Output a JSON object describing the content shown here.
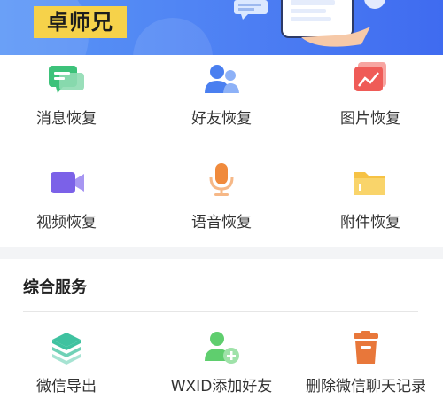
{
  "banner": {
    "brand": "卓师兄"
  },
  "recovery": {
    "items": [
      {
        "label": "消息恢复",
        "icon": "message-icon"
      },
      {
        "label": "好友恢复",
        "icon": "friends-icon"
      },
      {
        "label": "图片恢复",
        "icon": "picture-icon"
      },
      {
        "label": "视频恢复",
        "icon": "video-icon"
      },
      {
        "label": "语音恢复",
        "icon": "microphone-icon"
      },
      {
        "label": "附件恢复",
        "icon": "folder-icon"
      }
    ]
  },
  "services": {
    "title": "综合服务",
    "items": [
      {
        "label": "微信导出",
        "icon": "layers-export-icon"
      },
      {
        "label": "WXID添加好友",
        "icon": "add-friend-icon"
      },
      {
        "label": "删除微信聊天记录",
        "icon": "trash-icon"
      }
    ]
  },
  "colors": {
    "banner": "#4d7ff3",
    "brand_badge": "#f6d24a",
    "message": "#3dc27a",
    "friends": "#4a7ff0",
    "picture": "#ef5b57",
    "video": "#7b61e8",
    "microphone": "#f08a3c",
    "folder": "#f6c244",
    "export": "#3fc2a0",
    "add_friend": "#5fce6e",
    "trash": "#e8773a"
  }
}
